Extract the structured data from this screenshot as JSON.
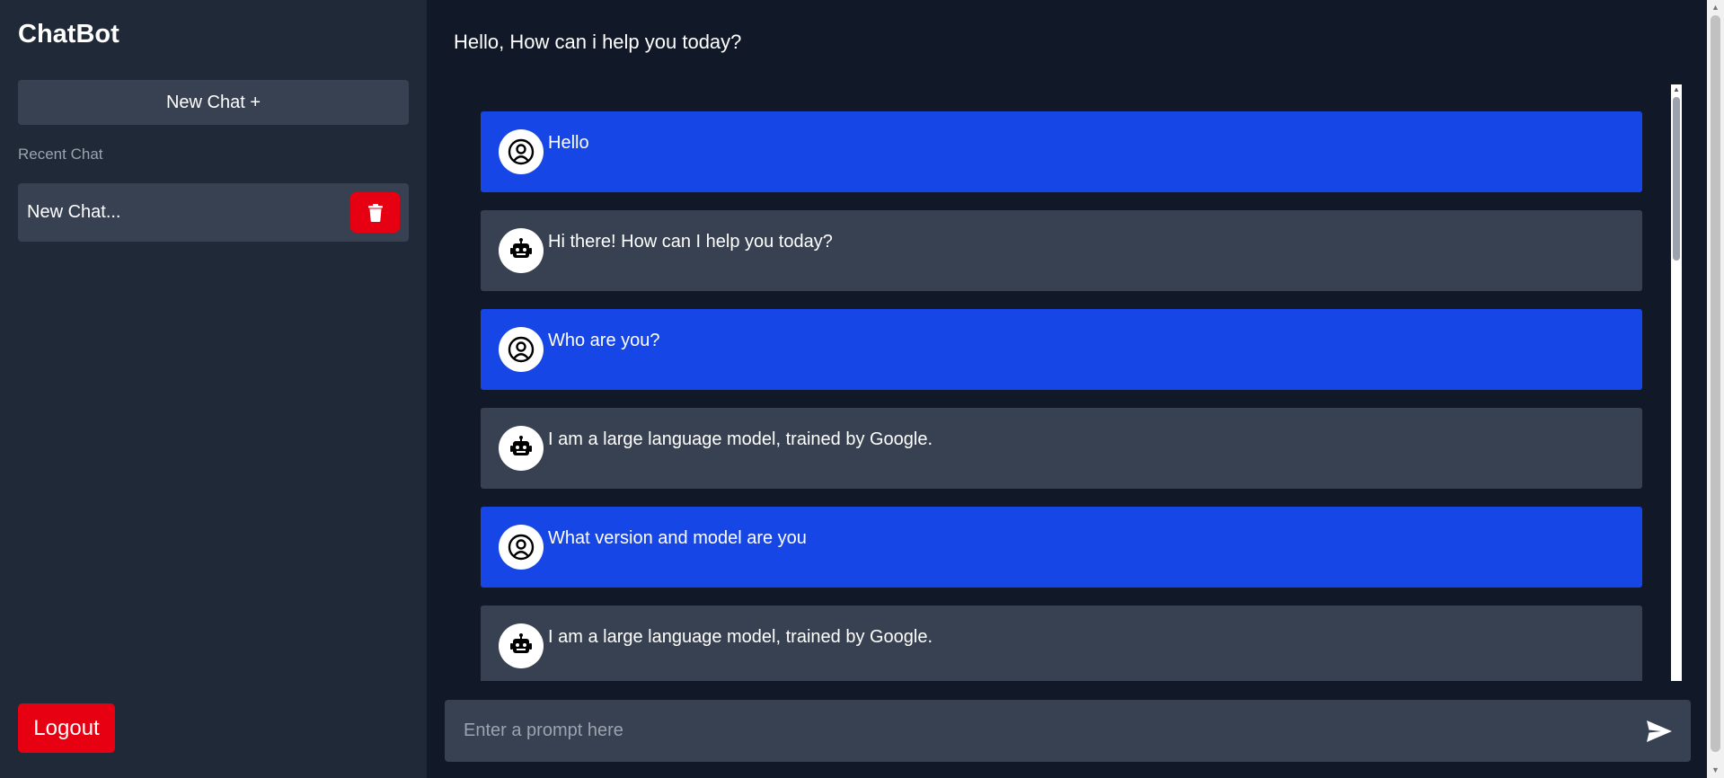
{
  "sidebar": {
    "brand": "ChatBot",
    "new_chat_label": "New Chat +",
    "recent_heading": "Recent Chat",
    "recent_items": [
      {
        "label": "New Chat..."
      }
    ],
    "logout_label": "Logout"
  },
  "main": {
    "greeting": "Hello, How can i help you today?",
    "messages": [
      {
        "role": "user",
        "text": "Hello"
      },
      {
        "role": "bot",
        "text": "Hi there! How can I help you today?"
      },
      {
        "role": "user",
        "text": "Who are you?"
      },
      {
        "role": "bot",
        "text": "I am a large language model, trained by Google."
      },
      {
        "role": "user",
        "text": "What version and model are you"
      },
      {
        "role": "bot",
        "text": "I am a large language model, trained by Google."
      }
    ],
    "prompt_placeholder": "Enter a prompt here",
    "prompt_value": ""
  },
  "colors": {
    "sidebar_bg": "#1f2937",
    "main_bg": "#111827",
    "user_message_bg": "#1746e6",
    "bot_message_bg": "#374151",
    "danger": "#e60012"
  },
  "icons": {
    "delete": "trash-icon",
    "user_avatar": "user-circle-icon",
    "bot_avatar": "robot-icon",
    "send": "send-icon"
  }
}
